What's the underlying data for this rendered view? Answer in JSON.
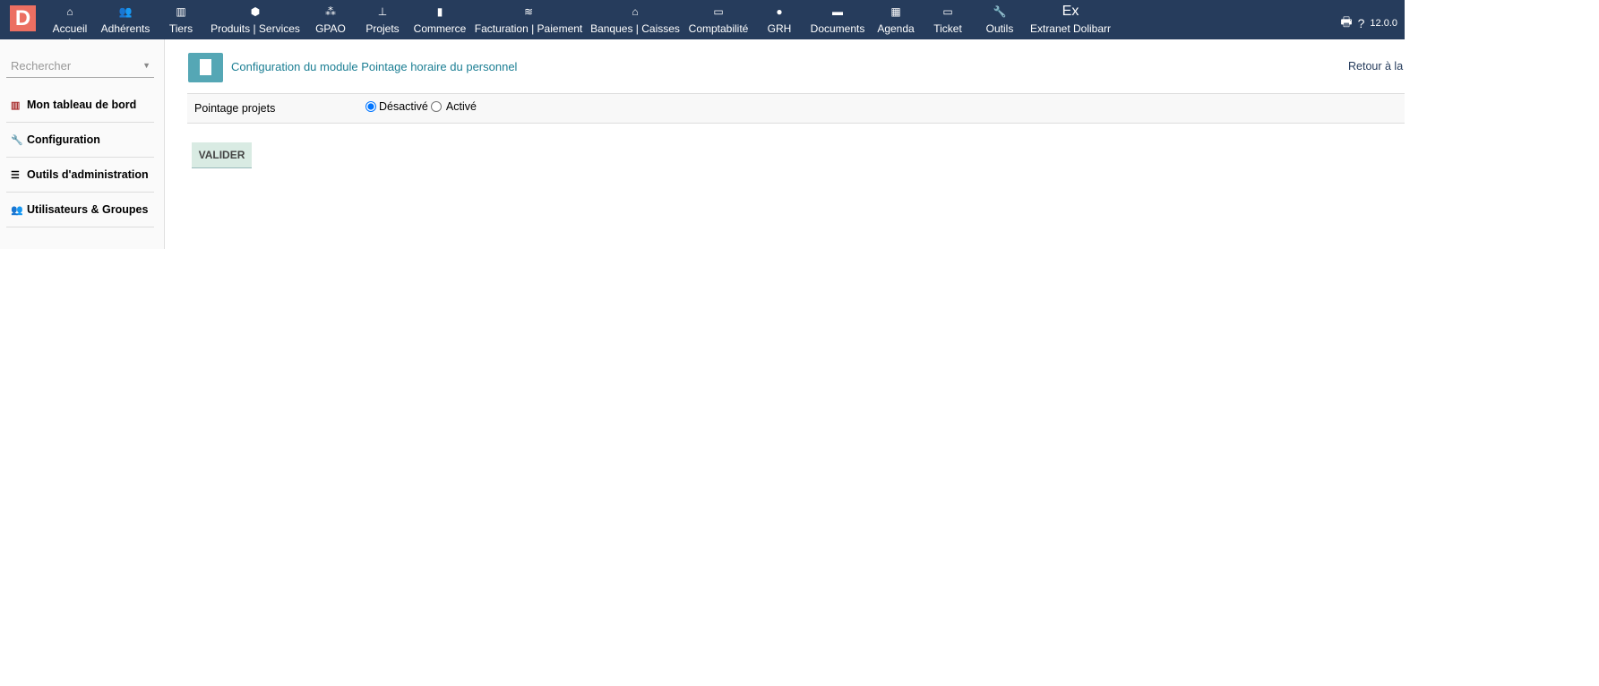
{
  "topbar": {
    "logo": "D",
    "nav": [
      {
        "label": "Accueil",
        "icon": "home-icon",
        "glyph": "⌂",
        "selected": true
      },
      {
        "label": "Adhérents",
        "icon": "users-icon",
        "glyph": "👥"
      },
      {
        "label": "Tiers",
        "icon": "building-icon",
        "glyph": "▥"
      },
      {
        "label": "Produits | Services",
        "icon": "cube-icon",
        "glyph": "⬢"
      },
      {
        "label": "GPAO",
        "icon": "cubes-icon",
        "glyph": "⁂"
      },
      {
        "label": "Projets",
        "icon": "sitemap-icon",
        "glyph": "⊥"
      },
      {
        "label": "Commerce",
        "icon": "suitcase-icon",
        "glyph": "▮"
      },
      {
        "label": "Facturation | Paiement",
        "icon": "coins-icon",
        "glyph": "≋"
      },
      {
        "label": "Banques | Caisses",
        "icon": "bank-icon",
        "glyph": "⌂"
      },
      {
        "label": "Comptabilité",
        "icon": "money-check-icon",
        "glyph": "▭"
      },
      {
        "label": "GRH",
        "icon": "user-tie-icon",
        "glyph": "●"
      },
      {
        "label": "Documents",
        "icon": "folder-icon",
        "glyph": "▬"
      },
      {
        "label": "Agenda",
        "icon": "calendar-icon",
        "glyph": "▦"
      },
      {
        "label": "Ticket",
        "icon": "ticket-icon",
        "glyph": "▭"
      },
      {
        "label": "Outils",
        "icon": "wrench-icon",
        "glyph": "🔧"
      },
      {
        "label": "Extranet Dolibarr",
        "icon": "ex-icon",
        "glyph": "Ex"
      }
    ],
    "version": "12.0.0"
  },
  "sidebar": {
    "search_placeholder": "Rechercher",
    "items": [
      {
        "label": "Mon tableau de bord",
        "icon": "chart-icon",
        "glyph": "📊"
      },
      {
        "label": "Configuration",
        "icon": "wrench-icon",
        "glyph": "🔧"
      },
      {
        "label": "Outils d'administration",
        "icon": "server-icon",
        "glyph": "☰"
      },
      {
        "label": "Utilisateurs & Groupes",
        "icon": "users-icon",
        "glyph": "👥"
      }
    ]
  },
  "main": {
    "title": "Configuration du module Pointage horaire du personnel",
    "back_link": "Retour à la",
    "setting": {
      "label": "Pointage projets",
      "options": [
        "Désactivé",
        "Activé"
      ],
      "selected": "Désactivé"
    },
    "submit": "VALIDER"
  }
}
